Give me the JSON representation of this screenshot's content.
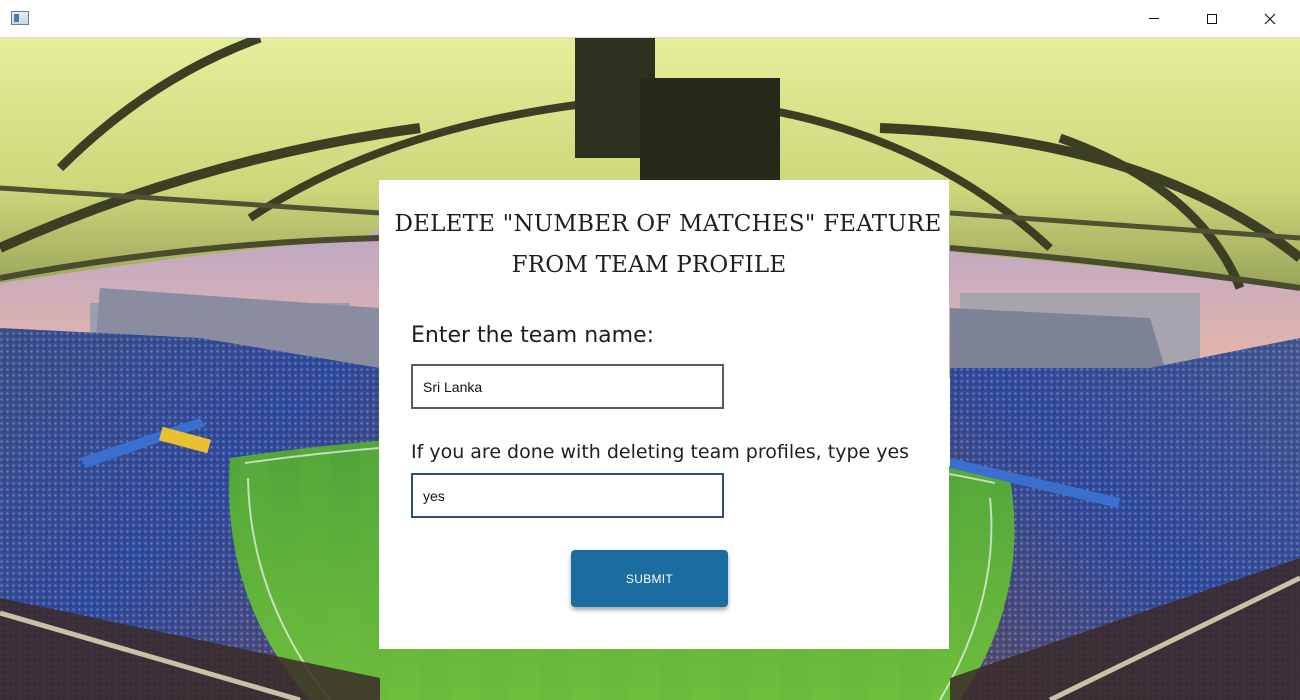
{
  "window": {
    "title": "",
    "controls": {
      "minimize_icon": "minimize-icon",
      "maximize_icon": "maximize-icon",
      "close_icon": "close-icon"
    }
  },
  "background": {
    "description_icon": "stadium-background-image"
  },
  "form": {
    "title_line1": "DELETE \"NUMBER OF MATCHES\" FEATURE",
    "title_line2": "FROM TEAM PROFILE",
    "team_label": "Enter the team name:",
    "team_value": "Sri Lanka",
    "done_label": "If you are done with deleting team profiles, type yes",
    "done_value": "yes",
    "submit_label": "SUBMIT"
  },
  "colors": {
    "submit_button": "#1b6da0",
    "card_background": "#ffffff",
    "field_focus_border": "#2f4f70"
  }
}
